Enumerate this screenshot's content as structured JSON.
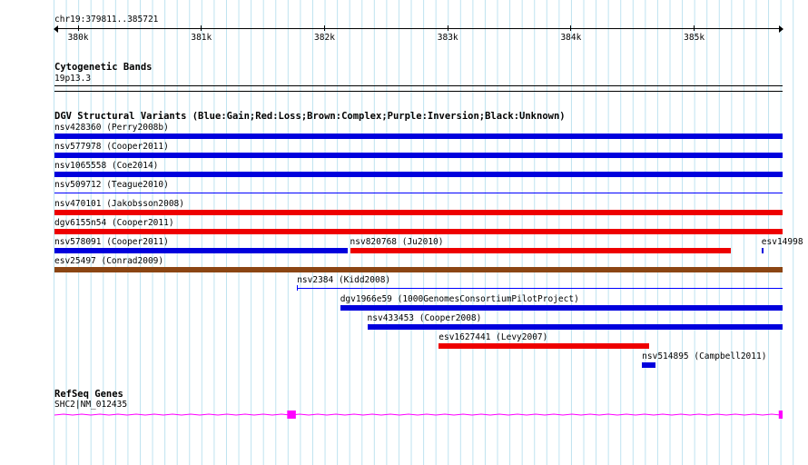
{
  "ruler": {
    "position_label": "chr19:379811..385721",
    "ticks": [
      "380k",
      "381k",
      "382k",
      "383k",
      "384k",
      "385k"
    ]
  },
  "cytoband": {
    "title": "Cytogenetic Bands",
    "band": "19p13.3"
  },
  "dgv": {
    "title": "DGV Structural Variants (Blue:Gain;Red:Loss;Brown:Complex;Purple:Inversion;Black:Unknown)",
    "colors": {
      "gain": "#0000dd",
      "loss": "#ee0000",
      "complex": "#8b4513",
      "outline": "#0000ff"
    },
    "variants": [
      {
        "label": "nsv428360 (Perry2008b)",
        "type": "gain",
        "start": 379811,
        "end": 385721
      },
      {
        "label": "nsv577978 (Cooper2011)",
        "type": "gain",
        "start": 379811,
        "end": 385721
      },
      {
        "label": "nsv1065558 (Coe2014)",
        "type": "gain",
        "start": 379811,
        "end": 385721
      },
      {
        "label": "nsv509712 (Teague2010)",
        "type": "thin",
        "start": 379811,
        "end": 385721
      },
      {
        "label": "nsv470101 (Jakobsson2008)",
        "type": "loss",
        "start": 379811,
        "end": 385721
      },
      {
        "label": "dgv6155n54 (Cooper2011)",
        "type": "loss",
        "start": 379811,
        "end": 385721
      },
      {
        "label": "nsv578091 (Cooper2011)",
        "type": "gain",
        "start": 379811,
        "end": 382190
      },
      {
        "label": "nsv820768 (Ju2010)",
        "type": "loss",
        "start": 382210,
        "end": 385300
      },
      {
        "label": "esv14998",
        "type": "gain",
        "start": 385550,
        "end": 385565
      },
      {
        "label": "esv25497 (Conrad2009)",
        "type": "complex",
        "start": 379811,
        "end": 385721
      },
      {
        "label": "nsv2384 (Kidd2008)",
        "type": "thin",
        "start": 381780,
        "end": 385721
      },
      {
        "label": "dgv1966e59 (1000GenomesConsortiumPilotProject)",
        "type": "gain",
        "start": 382130,
        "end": 385721
      },
      {
        "label": "nsv433453 (Cooper2008)",
        "type": "gain",
        "start": 382350,
        "end": 385721
      },
      {
        "label": "esv1627441 (Levy2007)",
        "type": "loss",
        "start": 382930,
        "end": 384640
      },
      {
        "label": "nsv514895 (Campbell2011)",
        "type": "gain",
        "start": 384580,
        "end": 384690
      }
    ]
  },
  "refseq": {
    "title": "RefSeq Genes",
    "gene": "SHC2|NM_012435",
    "color": "#ff00ff",
    "exons": [
      {
        "start": 381700,
        "end": 381770
      },
      {
        "start": 385690,
        "end": 385721
      }
    ]
  }
}
